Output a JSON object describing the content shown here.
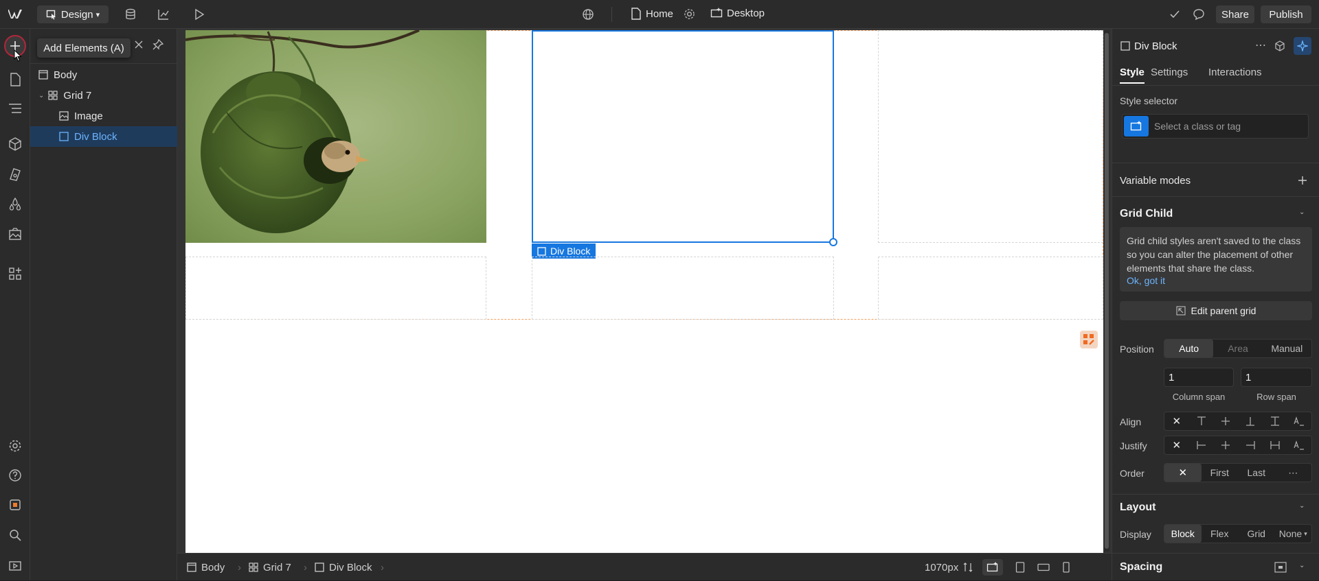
{
  "topbar": {
    "mode_label": "Design",
    "page_name": "Home",
    "breakpoint_label": "Desktop",
    "share_label": "Share",
    "publish_label": "Publish"
  },
  "tooltip": {
    "text": "Add Elements (A)"
  },
  "navigator": {
    "items": [
      {
        "label": "Body",
        "icon": "box-icon"
      },
      {
        "label": "Grid 7",
        "icon": "grid-icon"
      },
      {
        "label": "Image",
        "icon": "image-icon"
      },
      {
        "label": "Div Block",
        "icon": "box-icon",
        "selected": true
      }
    ]
  },
  "canvas": {
    "selected_label": "Div Block",
    "image_alt": "Weaver bird peeking out of woven grass nest"
  },
  "bottombar": {
    "crumbs": [
      "Body",
      "Grid 7",
      "Div Block"
    ],
    "width_value": "1070px"
  },
  "rightpanel": {
    "element_name": "Div Block",
    "tabs": [
      "Style",
      "Settings",
      "Interactions"
    ],
    "style_selector_label": "Style selector",
    "style_selector_placeholder": "Select a class or tag",
    "variable_modes_label": "Variable modes",
    "grid_child_title": "Grid Child",
    "grid_child_notice": "Grid child styles aren't saved to the class so you can alter the placement of other elements that share the class.",
    "notice_ok": "Ok, got it",
    "edit_parent_grid": "Edit parent grid",
    "position_label": "Position",
    "position_options": [
      "Auto",
      "Area",
      "Manual"
    ],
    "column_span_value": "1",
    "row_span_value": "1",
    "column_span_label": "Column span",
    "row_span_label": "Row span",
    "align_label": "Align",
    "justify_label": "Justify",
    "order_label": "Order",
    "order_options": [
      "First",
      "Last"
    ],
    "layout_title": "Layout",
    "display_label": "Display",
    "display_options": [
      "Block",
      "Flex",
      "Grid",
      "None"
    ],
    "spacing_title": "Spacing"
  },
  "colors": {
    "accent": "#1677e0",
    "publish_bg": "#3c3c3c",
    "grid_outline": "#f0a060"
  }
}
